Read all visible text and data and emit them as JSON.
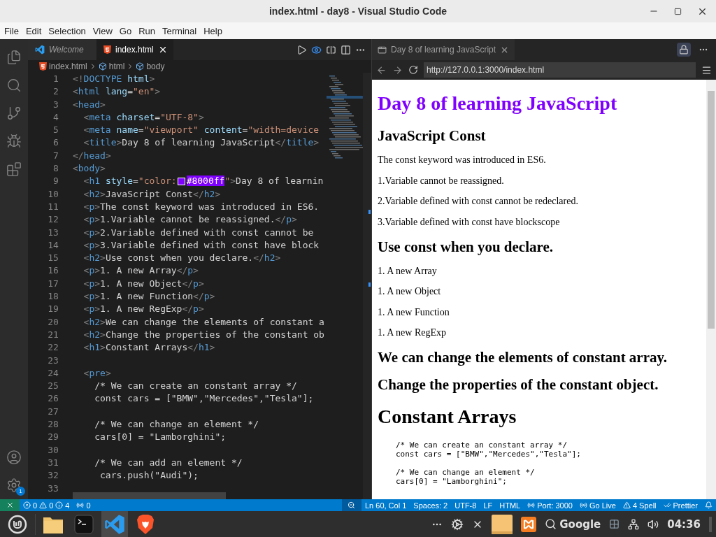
{
  "window": {
    "title": "index.html - day8 - Visual Studio Code"
  },
  "menu": [
    "File",
    "Edit",
    "Selection",
    "View",
    "Go",
    "Run",
    "Terminal",
    "Help"
  ],
  "activity_bar": {
    "badge": "1"
  },
  "editor": {
    "tabs": [
      {
        "label": "Welcome",
        "selected": false,
        "kind": "welcome"
      },
      {
        "label": "index.html",
        "selected": true,
        "kind": "html"
      }
    ],
    "breadcrumbs": [
      {
        "label": "index.html",
        "kind": "file"
      },
      {
        "label": "html",
        "kind": "element"
      },
      {
        "label": "body",
        "kind": "element"
      }
    ],
    "lines": [
      {
        "n": "1",
        "code": "<!DOCTYPE html>"
      },
      {
        "n": "2",
        "code": "<html lang=\"en\">"
      },
      {
        "n": "3",
        "code": "<head>"
      },
      {
        "n": "4",
        "code": "  <meta charset=\"UTF-8\">"
      },
      {
        "n": "5",
        "code": "  <meta name=\"viewport\" content=\"width=device"
      },
      {
        "n": "6",
        "code": "  <title>Day 8 of learning JavaScript</title>"
      },
      {
        "n": "7",
        "code": "</head>"
      },
      {
        "n": "8",
        "code": "<body>"
      },
      {
        "n": "9",
        "code": "  <h1 style=\"color:",
        "code_after_swatch": "#8000ff\">Day 8 of learnin"
      },
      {
        "n": "10",
        "code": "  <h2>JavaScript Const</h2>"
      },
      {
        "n": "11",
        "code": "  <p>The const keyword was introduced in ES6."
      },
      {
        "n": "12",
        "code": "  <p>1.Variable cannot be reassigned.</p>"
      },
      {
        "n": "13",
        "code": "  <p>2.Variable defined with const cannot be"
      },
      {
        "n": "14",
        "code": "  <p>3.Variable defined with const have block"
      },
      {
        "n": "15",
        "code": "  <h2>Use const when you declare.</h2>"
      },
      {
        "n": "16",
        "code": "  <p>1. A new Array</p>"
      },
      {
        "n": "17",
        "code": "  <p>1. A new Object</p>"
      },
      {
        "n": "18",
        "code": "  <p>1. A new Function</p>"
      },
      {
        "n": "19",
        "code": "  <p>1. A new RegExp</p>"
      },
      {
        "n": "20",
        "code": "  <h2>We can change the elements of constant a"
      },
      {
        "n": "21",
        "code": "  <h2>Change the properties of the constant ob"
      },
      {
        "n": "22",
        "code": "  <h1>Constant Arrays</h1>"
      },
      {
        "n": "23"
      },
      {
        "n": "24",
        "code": "  <pre>"
      },
      {
        "n": "25",
        "code": "    /* We can create an constant array */"
      },
      {
        "n": "26",
        "code": "    const cars = [\"BMW\",\"Mercedes\",\"Tesla\"];"
      },
      {
        "n": "27"
      },
      {
        "n": "28",
        "code": "    /* We can change an element */"
      },
      {
        "n": "29",
        "code": "    cars[0] = \"Lamborghini\";"
      },
      {
        "n": "30"
      },
      {
        "n": "31",
        "code": "    /* We can add an element */"
      },
      {
        "n": "32",
        "code": "     cars.push(\"Audi\");"
      },
      {
        "n": "33"
      }
    ]
  },
  "preview": {
    "tab": "Day 8 of learning JavaScript",
    "url": "http://127.0.0.1:3000/index.html",
    "content": [
      {
        "kind": "h1",
        "text": "Day 8 of learning JavaScript",
        "color": "#8000ff"
      },
      {
        "kind": "h2",
        "text": "JavaScript Const"
      },
      {
        "kind": "p",
        "text": "The const keyword was introduced in ES6."
      },
      {
        "kind": "p",
        "text": "1.Variable cannot be reassigned."
      },
      {
        "kind": "p",
        "text": "2.Variable defined with const cannot be redeclared."
      },
      {
        "kind": "p",
        "text": "3.Variable defined with const have blockscope"
      },
      {
        "kind": "h2",
        "text": "Use const when you declare."
      },
      {
        "kind": "p",
        "text": "1. A new Array"
      },
      {
        "kind": "p",
        "text": "1. A new Object"
      },
      {
        "kind": "p",
        "text": "1. A new Function"
      },
      {
        "kind": "p",
        "text": "1. A new RegExp"
      },
      {
        "kind": "h2",
        "text": "We can change the elements of constant array."
      },
      {
        "kind": "h2",
        "text": "Change the properties of the constant object."
      },
      {
        "kind": "h1",
        "text": "Constant Arrays",
        "color": "#000000"
      },
      {
        "kind": "pre",
        "blocks": [
          [
            "/* We can create an constant array */",
            "const cars = [\"BMW\",\"Mercedes\",\"Tesla\"];"
          ],
          [
            "/* We can change an element */",
            "cars[0] = \"Lamborghini\";"
          ]
        ]
      }
    ]
  },
  "status_bar": {
    "errors": "0",
    "warnings": "0",
    "infos": "4",
    "ports": "0",
    "items": [
      {
        "kind": "text",
        "text": "Ln 60, Col 1"
      },
      {
        "kind": "text",
        "text": "Spaces: 2"
      },
      {
        "kind": "text",
        "text": "UTF-8"
      },
      {
        "kind": "text",
        "text": "LF"
      },
      {
        "kind": "text",
        "text": "HTML"
      },
      {
        "kind": "port",
        "text": "Port: 3000"
      },
      {
        "kind": "live",
        "text": "Go Live"
      },
      {
        "kind": "spell",
        "text": "4 Spell"
      },
      {
        "kind": "prettier",
        "text": "Prettier"
      }
    ]
  },
  "taskbar": {
    "search": "Google",
    "clock": "04:36"
  }
}
